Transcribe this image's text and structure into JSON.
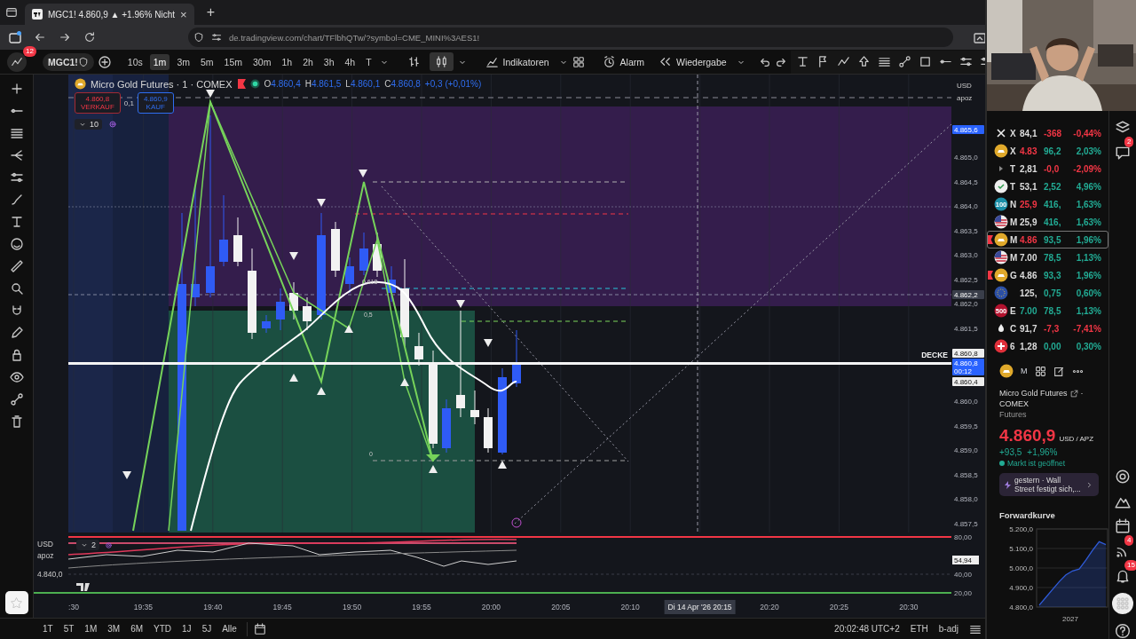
{
  "browser": {
    "tab": {
      "title": "MGC1! 4.860,9 ▲ +1.96% Nicht",
      "close": "×"
    },
    "new_tab": "+",
    "url": "de.tradingview.com/chart/TFlbhQTw/?symbol=CME_MINI%3AES1!"
  },
  "toolbar": {
    "badge": "12",
    "symbol": "MGC1!",
    "intervals": [
      {
        "label": "10s",
        "selected": false
      },
      {
        "label": "1m",
        "selected": true
      },
      {
        "label": "3m",
        "selected": false
      },
      {
        "label": "5m",
        "selected": false
      },
      {
        "label": "15m",
        "selected": false
      },
      {
        "label": "30m",
        "selected": false
      },
      {
        "label": "1h",
        "selected": false
      },
      {
        "label": "2h",
        "selected": false
      },
      {
        "label": "3h",
        "selected": false
      },
      {
        "label": "4h",
        "selected": false
      },
      {
        "label": "T",
        "selected": false
      }
    ],
    "chart_styles": [
      {
        "kind": "bars",
        "selected": false
      },
      {
        "kind": "candles",
        "selected": true
      }
    ],
    "indicators": "Indikatoren",
    "alarm": "Alarm",
    "replay": "Wiedergabe"
  },
  "chart": {
    "legend": {
      "title": "Micro Gold Futures · 1 · COMEX",
      "ohlc": [
        {
          "label": "O",
          "value": "4.860,4"
        },
        {
          "label": "H",
          "value": "4.861,5"
        },
        {
          "label": "L",
          "value": "4.860,1"
        },
        {
          "label": "C",
          "value": "4.860,8"
        }
      ],
      "change": "+0,3 (+0,01%)"
    },
    "sell": {
      "price": "4.860,8",
      "label": "VERKAUF"
    },
    "spread": "0,1",
    "buy": {
      "price": "4.860,9",
      "label": "KAUF"
    },
    "collapse_count": "10",
    "fib_labels": [
      "0,618",
      "0,5",
      "0"
    ],
    "line_label": "DECKE",
    "price_axis": {
      "currency": "USD",
      "unit": "apoz",
      "ticks": [
        "4.865,0",
        "4.864,5",
        "4.864,0",
        "4.863,5",
        "4.863,0",
        "4.862,5",
        "4.862,0",
        "4.861,5",
        "4.860,0",
        "4.859,5",
        "4.859,0",
        "4.858,5",
        "4.858,0",
        "4.857,5"
      ],
      "markers": [
        {
          "kind": "blue",
          "text": "4.865,6"
        },
        {
          "kind": "gray",
          "text": "4.862,2"
        },
        {
          "kind": "white",
          "text": "4.860,8"
        },
        {
          "kind": "blue",
          "text": "4.860,8"
        },
        {
          "kind": "blue",
          "text": "00:12"
        },
        {
          "kind": "white",
          "text": "4.860,4"
        }
      ]
    },
    "indicator": {
      "currency": "USD",
      "unit": "apoz",
      "count": "2",
      "left_label": "4.840,0",
      "ticks": [
        "80,00",
        "40,00",
        "20,00"
      ],
      "marker": "54,94"
    },
    "time_axis": [
      {
        "kind": "tick",
        "text": ":30"
      },
      {
        "kind": "tick",
        "text": "19:35"
      },
      {
        "kind": "tick",
        "text": "19:40"
      },
      {
        "kind": "tick",
        "text": "19:45"
      },
      {
        "kind": "tick",
        "text": "19:50"
      },
      {
        "kind": "tick",
        "text": "19:55"
      },
      {
        "kind": "tick",
        "text": "20:00"
      },
      {
        "kind": "tick",
        "text": "20:05"
      },
      {
        "kind": "tick",
        "text": "20:10"
      },
      {
        "kind": "crosshair",
        "text": "Di 14 Apr '26   20:15"
      },
      {
        "kind": "tick",
        "text": "20:20"
      },
      {
        "kind": "tick",
        "text": "20:25"
      },
      {
        "kind": "tick",
        "text": "20:30"
      }
    ]
  },
  "bottom_bar": {
    "ranges": [
      "1T",
      "5T",
      "1M",
      "3M",
      "6M",
      "YTD",
      "1J",
      "5J",
      "Alle"
    ],
    "clock": "20:02:48 UTC+2",
    "session": "ETH",
    "adjustment": "b-adj"
  },
  "watchlist": [
    {
      "kind": "x-logo",
      "symbol": "X",
      "last": {
        "text": "84,1",
        "color": "#dddddd"
      },
      "change": {
        "text": "-368",
        "color": "#f23645"
      },
      "percent": {
        "text": "-0,44%",
        "color": "#f23645"
      },
      "flagged": false,
      "selected": false
    },
    {
      "kind": "coin",
      "symbol": "X",
      "last": {
        "text": "4.83",
        "color": "#f23645"
      },
      "change": {
        "text": "96,2",
        "color": "#22ab94"
      },
      "percent": {
        "text": "2,03%",
        "color": "#22ab94"
      },
      "flagged": false,
      "selected": false
    },
    {
      "kind": "plain",
      "symbol": "T",
      "last": {
        "text": "2,81",
        "color": "#dddddd"
      },
      "change": {
        "text": "-0,0",
        "color": "#f23645"
      },
      "percent": {
        "text": "-2,09%",
        "color": "#f23645"
      },
      "flagged": false,
      "selected": false
    },
    {
      "kind": "check",
      "symbol": "T",
      "last": {
        "text": "53,1",
        "color": "#dddddd"
      },
      "change": {
        "text": "2,52",
        "color": "#22ab94"
      },
      "percent": {
        "text": "4,96%",
        "color": "#22ab94"
      },
      "flagged": false,
      "selected": false
    },
    {
      "kind": "badge",
      "badge": "100",
      "symbol": "N",
      "last": {
        "text": "25,9",
        "color": "#f23645"
      },
      "change": {
        "text": "416,",
        "color": "#22ab94"
      },
      "percent": {
        "text": "1,63%",
        "color": "#22ab94"
      },
      "flagged": false,
      "selected": false
    },
    {
      "kind": "flag-us",
      "symbol": "M",
      "last": {
        "text": "25,9",
        "color": "#dddddd"
      },
      "change": {
        "text": "416,",
        "color": "#22ab94"
      },
      "percent": {
        "text": "1,63%",
        "color": "#22ab94"
      },
      "flagged": false,
      "selected": false
    },
    {
      "kind": "coin",
      "symbol": "M",
      "last": {
        "text": "4.86",
        "color": "#f23645"
      },
      "change": {
        "text": "93,5",
        "color": "#22ab94"
      },
      "percent": {
        "text": "1,96%",
        "color": "#22ab94"
      },
      "flagged": true,
      "selected": true
    },
    {
      "kind": "flag-us",
      "symbol": "M",
      "last": {
        "text": "7.00",
        "color": "#dddddd"
      },
      "change": {
        "text": "78,5",
        "color": "#22ab94"
      },
      "percent": {
        "text": "1,13%",
        "color": "#22ab94"
      },
      "flagged": false,
      "selected": false
    },
    {
      "kind": "coin",
      "symbol": "G",
      "last": {
        "text": "4.86",
        "color": "#dddddd"
      },
      "change": {
        "text": "93,3",
        "color": "#22ab94"
      },
      "percent": {
        "text": "1,96%",
        "color": "#22ab94"
      },
      "flagged": true,
      "selected": false
    },
    {
      "kind": "flag-eu",
      "last": {
        "text": "125,",
        "color": "#dddddd"
      },
      "change": {
        "text": "0,75",
        "color": "#22ab94"
      },
      "percent": {
        "text": "0,60%",
        "color": "#22ab94"
      },
      "flagged": false,
      "selected": false
    },
    {
      "kind": "badge",
      "badge": "500",
      "symbol": "E",
      "last": {
        "text": "7.00",
        "color": "#22ab94"
      },
      "change": {
        "text": "78,5",
        "color": "#22ab94"
      },
      "percent": {
        "text": "1,13%",
        "color": "#22ab94"
      },
      "flagged": false,
      "selected": false
    },
    {
      "kind": "drop",
      "symbol": "C",
      "last": {
        "text": "91,7",
        "color": "#dddddd"
      },
      "change": {
        "text": "-7,3",
        "color": "#f23645"
      },
      "percent": {
        "text": "-7,41%",
        "color": "#f23645"
      },
      "flagged": false,
      "selected": false
    },
    {
      "kind": "swiss",
      "symbol": "6",
      "last": {
        "text": "1,28",
        "color": "#dddddd"
      },
      "change": {
        "text": "0,00",
        "color": "#22ab94"
      },
      "percent": {
        "text": "0,30%",
        "color": "#22ab94"
      },
      "flagged": false,
      "selected": false
    }
  ],
  "details": {
    "symbol": "M",
    "name": "Micro Gold Futures",
    "separator": "·",
    "exchange": "COMEX",
    "type": "Futures",
    "price": "4.860,9",
    "currency": "USD / APZ",
    "change": "+93,5",
    "change_percent": "+1,96%",
    "status": "Markt ist geöffnet",
    "news": "gestern · Wall Street festigt sich,...",
    "forward": {
      "title": "Forwardkurve",
      "chart_data": {
        "type": "area",
        "xlabel": "2027",
        "grid": true,
        "series": [
          {
            "color": "#2f5bd8",
            "values": [
              4810,
              4850,
              4890,
              4930,
              4965,
              4985,
              4995,
              5040,
              5090,
              5135,
              5120
            ]
          }
        ],
        "ylim": [
          4800,
          5200
        ],
        "yticks": [
          {
            "value": 4800,
            "label": "4.800,0"
          },
          {
            "value": 4900,
            "label": "4.900,0"
          },
          {
            "value": 5000,
            "label": "5.000,0"
          },
          {
            "value": 5100,
            "label": "5.100,0"
          },
          {
            "value": 5200,
            "label": "5.200,0"
          }
        ]
      }
    }
  },
  "right_bar": [
    {
      "kind": "layers"
    },
    {
      "kind": "chat",
      "badge": "2"
    },
    {
      "kind": "spacer"
    },
    {
      "kind": "target"
    },
    {
      "kind": "mountain"
    },
    {
      "kind": "calendar"
    },
    {
      "kind": "feed",
      "badge": "4"
    },
    {
      "kind": "bell",
      "badge": "15"
    },
    {
      "kind": "grid"
    },
    {
      "kind": "help"
    }
  ]
}
